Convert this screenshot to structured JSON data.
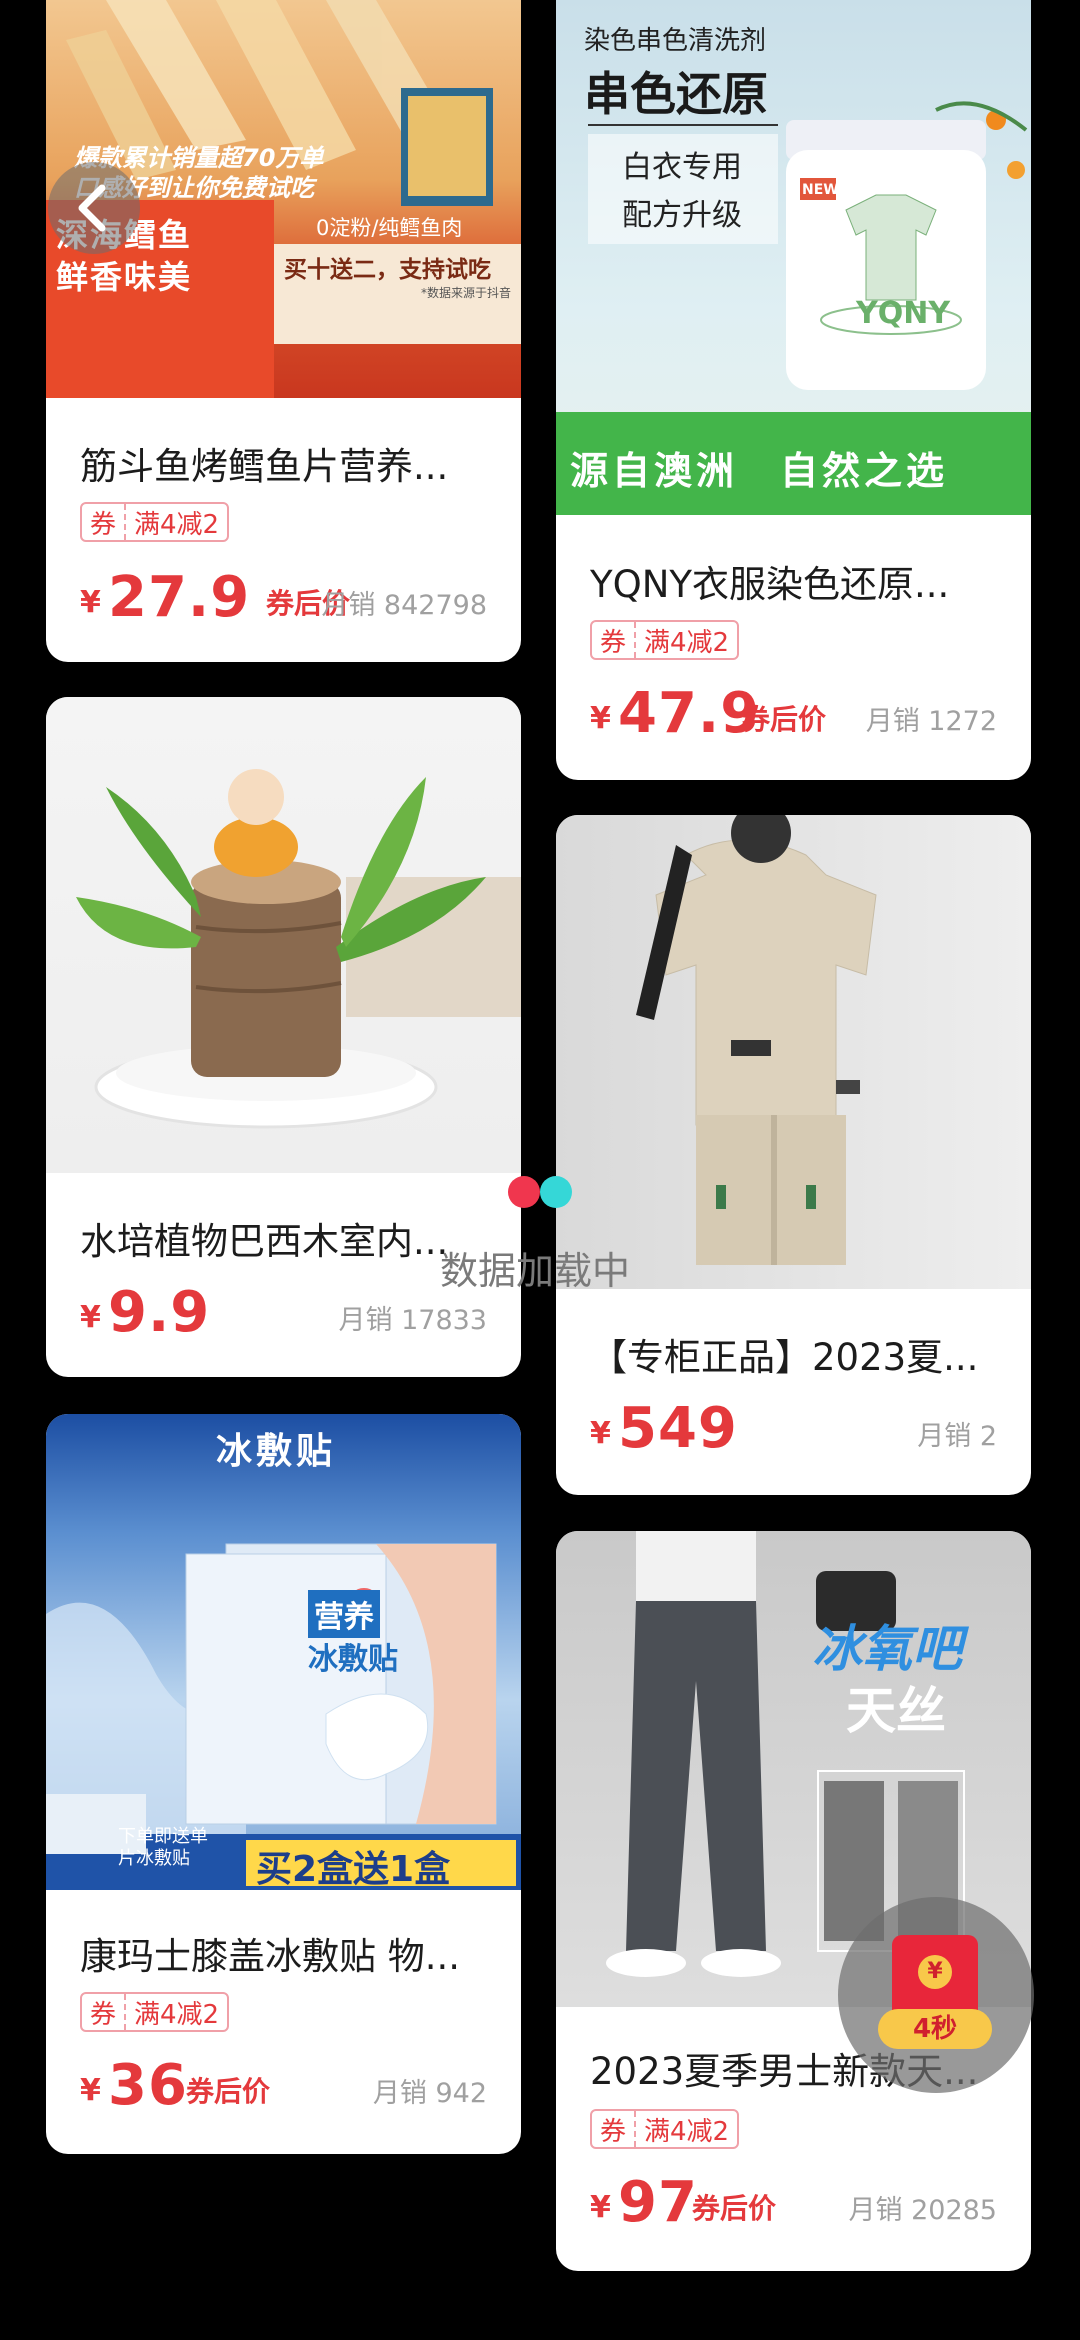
{
  "loading_text": "数据加载中",
  "timer": {
    "text": "4秒",
    "symbol": "¥"
  },
  "products": [
    {
      "title": "筋斗鱼烤鳕鱼片营养...",
      "coupon": {
        "tag": "券",
        "text": "满4减2"
      },
      "currency": "¥",
      "price": "27.9",
      "after": "券后价",
      "sales": "月销 842798",
      "banner": {
        "line1": "爆款累计销量超70万单",
        "line2": "口感好到让你免费试吃",
        "tag1": "深海鳕鱼",
        "tag2": "鲜香味美",
        "sub": "0淀粉/纯鳕鱼肉",
        "promo": "买十送二，支持试吃",
        "note": "*数据来源于抖音"
      }
    },
    {
      "title": "YQNY衣服染色还原...",
      "coupon": {
        "tag": "券",
        "text": "满4减2"
      },
      "currency": "¥",
      "price": "47.9",
      "after": "券后价",
      "sales": "月销 1272",
      "banner": {
        "small": "染色串色清洗剂",
        "big": "串色还原",
        "line1": "白衣专用",
        "line2": "配方升级",
        "brand": "YQNY",
        "new": "NEW",
        "bottom": "源自澳洲　自然之选"
      }
    },
    {
      "title": "水培植物巴西木室内...",
      "currency": "¥",
      "price": "9.9",
      "sales": "月销 17833"
    },
    {
      "title": "【专柜正品】2023夏...",
      "currency": "¥",
      "price": "549",
      "sales": "月销 2"
    },
    {
      "title": "康玛士膝盖冰敷贴 物...",
      "coupon": {
        "tag": "券",
        "text": "满4减2"
      },
      "currency": "¥",
      "price": "36",
      "after": "券后价",
      "sales": "月销 942",
      "banner": {
        "top": "冰敷贴",
        "box1": "营养",
        "box2": "冰敷贴",
        "free": "下单即送单片冰敷贴",
        "promo": "买2盒送1盒"
      }
    },
    {
      "title": "2023夏季男士新款天...",
      "coupon": {
        "tag": "券",
        "text": "满4减2"
      },
      "currency": "¥",
      "price": "97",
      "after": "券后价",
      "sales": "月销 20285",
      "banner": {
        "line1": "冰氧吧",
        "line2": "天丝"
      }
    }
  ]
}
